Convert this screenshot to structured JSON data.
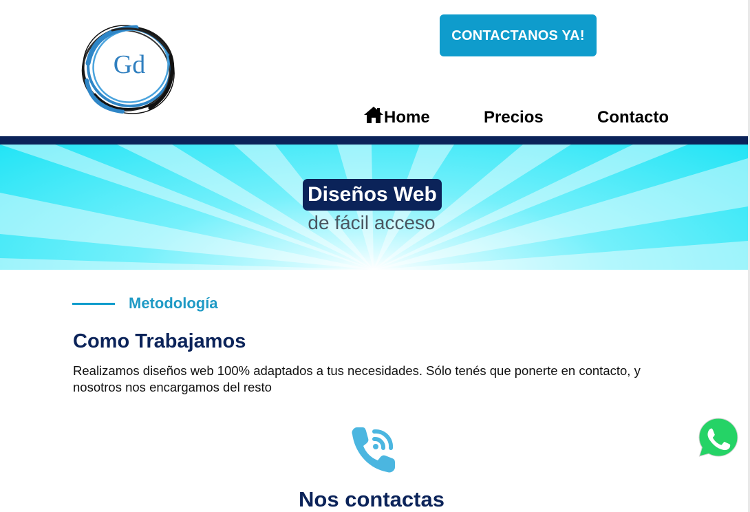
{
  "header": {
    "logo_text": "Gd",
    "cta_label": "CONTACTANOS YA!",
    "nav": [
      {
        "label": "Home",
        "icon": "home-icon"
      },
      {
        "label": "Precios"
      },
      {
        "label": "Contacto"
      }
    ]
  },
  "hero": {
    "title": "Diseños Web",
    "subtitle": "de fácil acceso"
  },
  "methodology": {
    "label": "Metodología",
    "heading": "Como Trabajamos",
    "text": "Realizamos diseños web 100% adaptados a tus necesidades. Sólo tenés que ponerte en contacto, y nosotros nos encargamos del resto"
  },
  "contact": {
    "icon": "phone-call-icon",
    "heading": "Nos contactas"
  },
  "floating": {
    "icon": "whatsapp-icon"
  },
  "colors": {
    "navy": "#0b2359",
    "accent": "#0f9ccc",
    "hero_cyan": "#22e4f5",
    "whatsapp_green": "#25d366"
  }
}
